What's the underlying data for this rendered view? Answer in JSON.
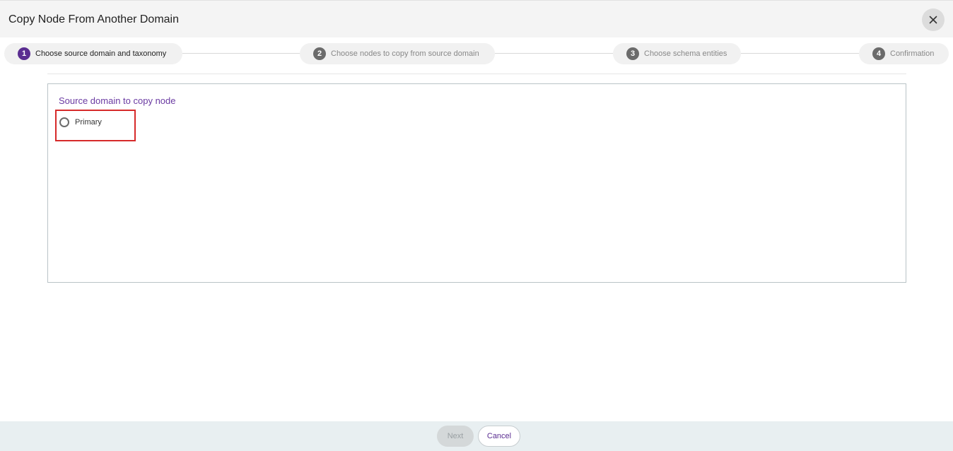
{
  "dialog": {
    "title": "Copy Node From Another Domain",
    "close_icon": "close-icon"
  },
  "stepper": {
    "steps": [
      {
        "number": "1",
        "label": "Choose source domain and taxonomy",
        "active": true
      },
      {
        "number": "2",
        "label": "Choose nodes to copy from source domain",
        "active": false
      },
      {
        "number": "3",
        "label": "Choose schema entities",
        "active": false
      },
      {
        "number": "4",
        "label": "Confirmation",
        "active": false
      }
    ]
  },
  "source_panel": {
    "label": "Source domain to copy node",
    "options": [
      {
        "label": "Primary",
        "selected": false
      }
    ]
  },
  "footer": {
    "next_label": "Next",
    "cancel_label": "Cancel"
  },
  "colors": {
    "accent": "#5a2d91",
    "highlight": "#d62a2a",
    "footer_bg": "#e8eff1"
  }
}
